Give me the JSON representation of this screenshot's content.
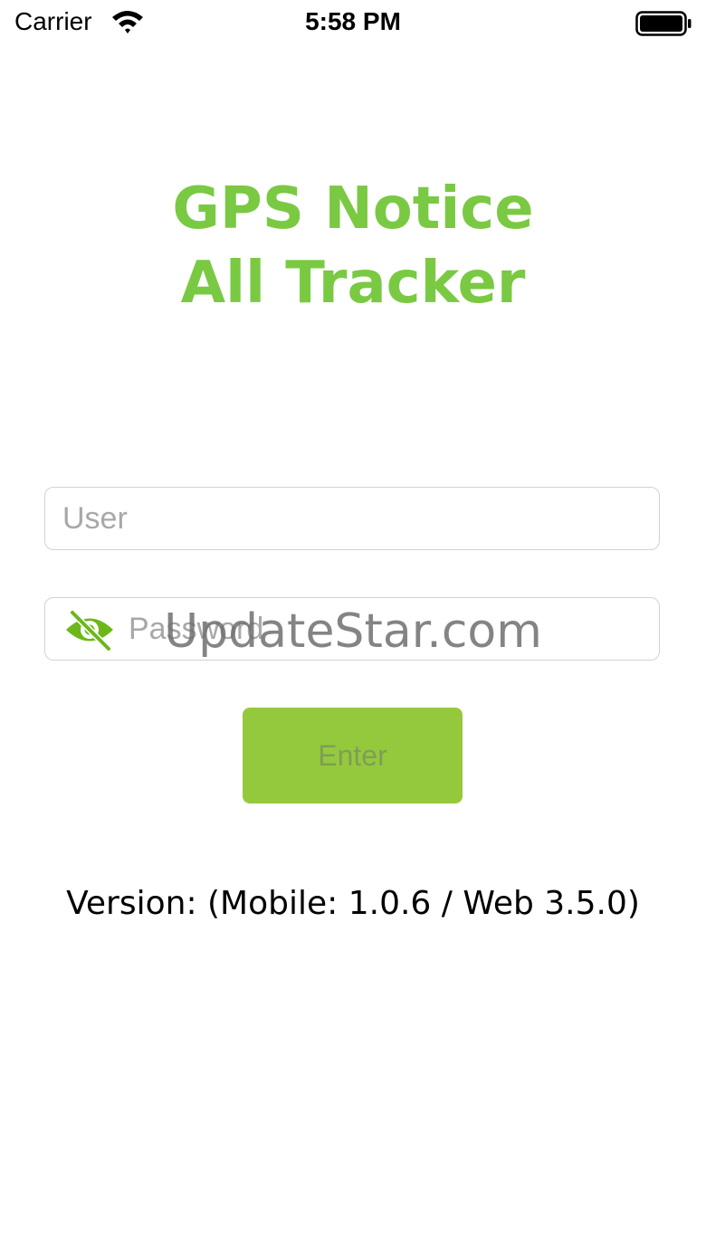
{
  "status_bar": {
    "carrier": "Carrier",
    "time": "5:58 PM",
    "wifi_icon": "wifi-icon",
    "battery_icon": "battery-icon"
  },
  "title": {
    "line1": "GPS Notice",
    "line2": "All Tracker"
  },
  "form": {
    "user_placeholder": "User",
    "user_value": "",
    "password_placeholder": "Password",
    "password_value": "",
    "eye_icon": "eye-slash-icon",
    "enter_label": "Enter"
  },
  "watermark": "UpdateStar.com",
  "version_text": "Version: (Mobile: 1.0.6 / Web 3.5.0)",
  "colors": {
    "brand_green": "#7ac943",
    "button_green": "#95c93d",
    "eye_green": "#6bb818"
  }
}
